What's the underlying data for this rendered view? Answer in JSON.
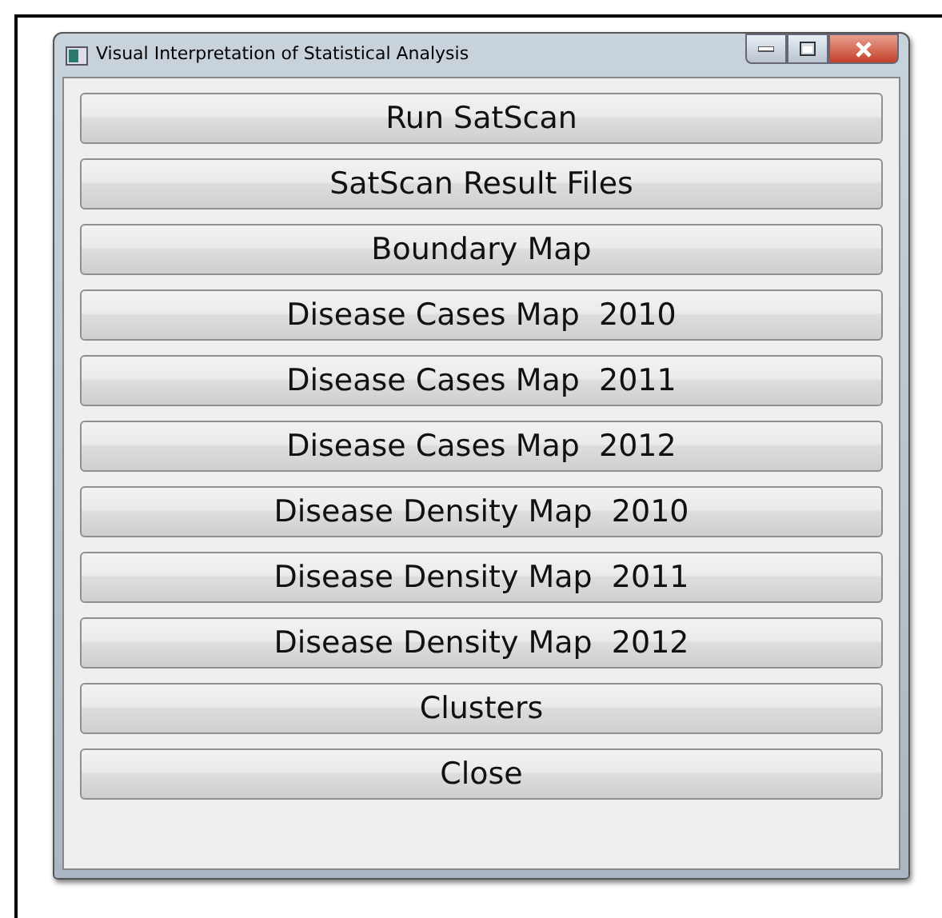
{
  "window": {
    "title": "Visual Interpretation of Statistical Analysis"
  },
  "buttons": [
    {
      "label": "Run SatScan"
    },
    {
      "label": "SatScan Result Files"
    },
    {
      "label": "Boundary Map"
    },
    {
      "label": "Disease Cases Map  2010"
    },
    {
      "label": "Disease Cases Map  2011"
    },
    {
      "label": "Disease Cases Map  2012"
    },
    {
      "label": "Disease Density Map  2010"
    },
    {
      "label": "Disease Density Map  2011"
    },
    {
      "label": "Disease Density Map  2012"
    },
    {
      "label": "Clusters"
    },
    {
      "label": "Close"
    }
  ]
}
